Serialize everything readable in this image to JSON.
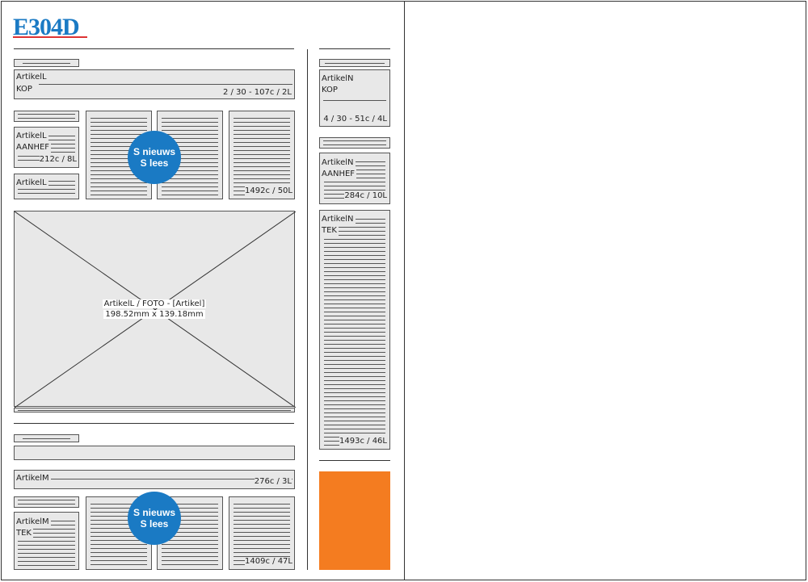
{
  "logo": {
    "text": "E304D",
    "color": "#1a7ac4"
  },
  "accent_colors": {
    "badge": "#1a7ac4",
    "block": "#f47c20"
  },
  "left_column": {
    "kop_block": {
      "name": "ArtikelL",
      "type": "KOP",
      "stats": "2 / 30 - 107c / 2L"
    },
    "aanhef_block": {
      "name": "ArtikelL",
      "type": "AANHEF",
      "stats": "212c / 8L"
    },
    "small_block": {
      "name": "ArtikelL"
    },
    "text_block": {
      "stats": "1492c / 50L"
    },
    "badge_top": {
      "line1": "S nieuws",
      "line2": "S lees"
    },
    "photo": {
      "caption_line1": "ArtikelL / FOTO - [Artikel]",
      "caption_line2": "198.52mm x 139.18mm"
    },
    "m_kop_block": {
      "name": "ArtikelM",
      "stats": "276c / 3L"
    },
    "m_tek_block": {
      "name": "ArtikelM",
      "type": "TEK",
      "stats": "1409c / 47L"
    },
    "badge_bottom": {
      "line1": "S nieuws",
      "line2": "S lees"
    }
  },
  "right_column": {
    "kop_block": {
      "name": "ArtikelN",
      "type": "KOP",
      "stats": "4 / 30 - 51c / 4L"
    },
    "aanhef_block": {
      "name": "ArtikelN",
      "type": "AANHEF",
      "stats": "284c / 10L"
    },
    "tek_block": {
      "name": "ArtikelN",
      "type": "TEK",
      "stats": "1493c / 46L"
    }
  }
}
